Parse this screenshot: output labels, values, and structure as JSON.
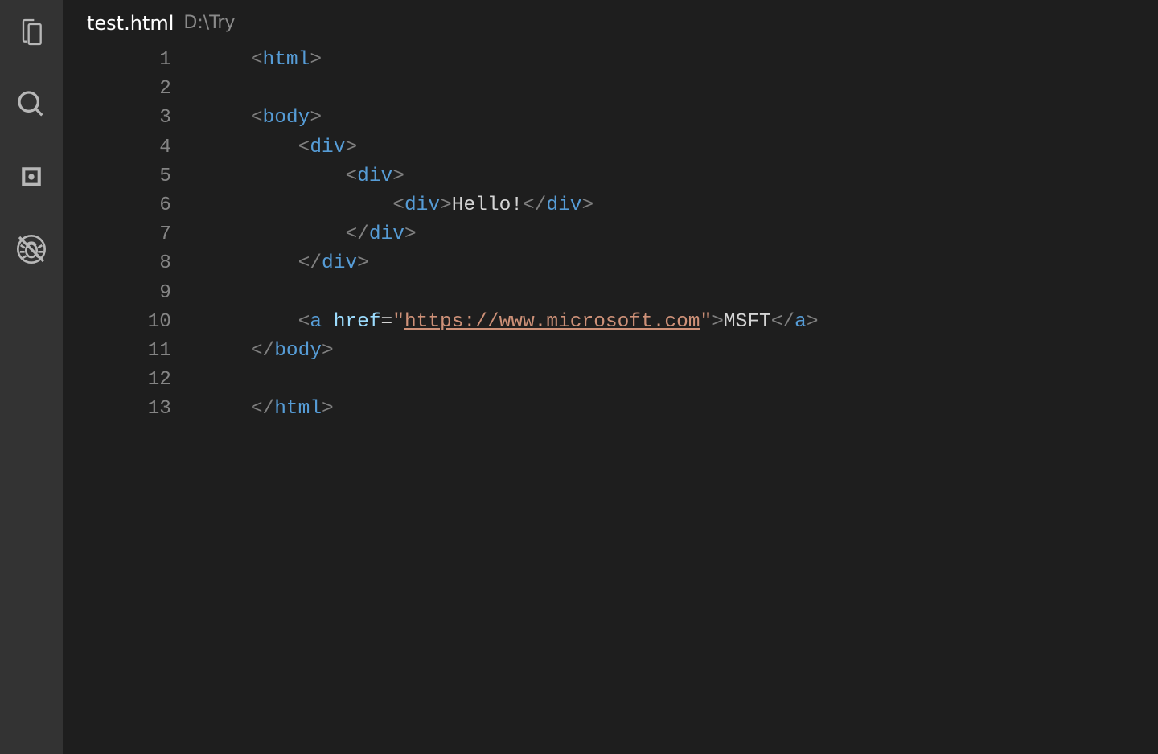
{
  "tab": {
    "filename": "test.html",
    "path": "D:\\Try"
  },
  "activity": {
    "explorer": "explorer",
    "search": "search",
    "scm": "source-control",
    "debug": "debug"
  },
  "editor": {
    "line_count": 13,
    "lines": [
      {
        "n": "1",
        "tokens": [
          {
            "t": "indent",
            "v": "    "
          },
          {
            "t": "bracket",
            "v": "<"
          },
          {
            "t": "tag",
            "v": "html"
          },
          {
            "t": "bracket",
            "v": ">"
          }
        ]
      },
      {
        "n": "2",
        "tokens": []
      },
      {
        "n": "3",
        "tokens": [
          {
            "t": "indent",
            "v": "    "
          },
          {
            "t": "bracket",
            "v": "<"
          },
          {
            "t": "tag",
            "v": "body"
          },
          {
            "t": "bracket",
            "v": ">"
          }
        ]
      },
      {
        "n": "4",
        "tokens": [
          {
            "t": "indent",
            "v": "        "
          },
          {
            "t": "bracket",
            "v": "<"
          },
          {
            "t": "tag",
            "v": "div"
          },
          {
            "t": "bracket",
            "v": ">"
          }
        ]
      },
      {
        "n": "5",
        "tokens": [
          {
            "t": "indent",
            "v": "            "
          },
          {
            "t": "bracket",
            "v": "<"
          },
          {
            "t": "tag",
            "v": "div"
          },
          {
            "t": "bracket",
            "v": ">"
          }
        ]
      },
      {
        "n": "6",
        "tokens": [
          {
            "t": "indent",
            "v": "                "
          },
          {
            "t": "bracket",
            "v": "<"
          },
          {
            "t": "tag",
            "v": "div"
          },
          {
            "t": "bracket",
            "v": ">"
          },
          {
            "t": "text",
            "v": "Hello!"
          },
          {
            "t": "bracket",
            "v": "</"
          },
          {
            "t": "tag",
            "v": "div"
          },
          {
            "t": "bracket",
            "v": ">"
          }
        ]
      },
      {
        "n": "7",
        "tokens": [
          {
            "t": "indent",
            "v": "            "
          },
          {
            "t": "bracket",
            "v": "</"
          },
          {
            "t": "tag",
            "v": "div"
          },
          {
            "t": "bracket",
            "v": ">"
          }
        ]
      },
      {
        "n": "8",
        "tokens": [
          {
            "t": "indent",
            "v": "        "
          },
          {
            "t": "bracket",
            "v": "</"
          },
          {
            "t": "tag",
            "v": "div"
          },
          {
            "t": "bracket",
            "v": ">"
          }
        ]
      },
      {
        "n": "9",
        "tokens": []
      },
      {
        "n": "10",
        "tokens": [
          {
            "t": "indent",
            "v": "        "
          },
          {
            "t": "bracket",
            "v": "<"
          },
          {
            "t": "tag",
            "v": "a"
          },
          {
            "t": "text",
            "v": " "
          },
          {
            "t": "attr",
            "v": "href"
          },
          {
            "t": "punct",
            "v": "="
          },
          {
            "t": "string",
            "v": "\""
          },
          {
            "t": "string-underline",
            "v": "https://www.microsoft.com"
          },
          {
            "t": "string",
            "v": "\""
          },
          {
            "t": "bracket",
            "v": ">"
          },
          {
            "t": "text",
            "v": "MSFT"
          },
          {
            "t": "bracket",
            "v": "</"
          },
          {
            "t": "tag",
            "v": "a"
          },
          {
            "t": "bracket",
            "v": ">"
          }
        ]
      },
      {
        "n": "11",
        "tokens": [
          {
            "t": "indent",
            "v": "    "
          },
          {
            "t": "bracket",
            "v": "</"
          },
          {
            "t": "tag",
            "v": "body"
          },
          {
            "t": "bracket",
            "v": ">"
          }
        ]
      },
      {
        "n": "12",
        "tokens": []
      },
      {
        "n": "13",
        "tokens": [
          {
            "t": "indent",
            "v": "    "
          },
          {
            "t": "bracket",
            "v": "</"
          },
          {
            "t": "tag",
            "v": "html"
          },
          {
            "t": "bracket",
            "v": ">"
          }
        ]
      }
    ]
  }
}
